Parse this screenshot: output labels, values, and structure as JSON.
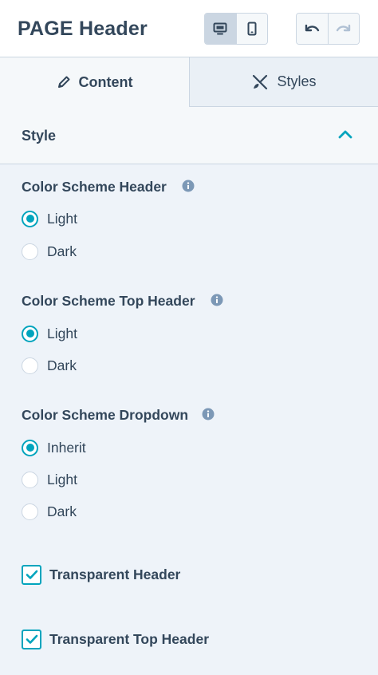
{
  "header": {
    "title": "PAGE Header",
    "device_buttons": [
      {
        "name": "desktop",
        "icon": "desktop-icon",
        "active": true
      },
      {
        "name": "mobile",
        "icon": "mobile-icon",
        "active": false
      }
    ],
    "history_buttons": [
      {
        "name": "undo",
        "icon": "undo-icon"
      },
      {
        "name": "redo",
        "icon": "redo-icon"
      }
    ]
  },
  "tabs": [
    {
      "label": "Content",
      "icon": "pencil-icon",
      "active": true
    },
    {
      "label": "Styles",
      "icon": "brush-ruler-icon",
      "active": false
    }
  ],
  "section": {
    "title": "Style",
    "expanded": true
  },
  "groups": [
    {
      "label": "Color Scheme Header",
      "options": [
        {
          "label": "Light",
          "selected": true
        },
        {
          "label": "Dark",
          "selected": false
        }
      ]
    },
    {
      "label": "Color Scheme Top Header",
      "options": [
        {
          "label": "Light",
          "selected": true
        },
        {
          "label": "Dark",
          "selected": false
        }
      ]
    },
    {
      "label": "Color Scheme Dropdown",
      "options": [
        {
          "label": "Inherit",
          "selected": true
        },
        {
          "label": "Light",
          "selected": false
        },
        {
          "label": "Dark",
          "selected": false
        }
      ]
    }
  ],
  "checkboxes": [
    {
      "label": "Transparent Header",
      "checked": true
    },
    {
      "label": "Transparent Top Header",
      "checked": true
    }
  ],
  "colors": {
    "accent": "#00a4bd",
    "text": "#33475b",
    "border": "#cbd6e2",
    "panel_bg": "#eef3f9"
  }
}
